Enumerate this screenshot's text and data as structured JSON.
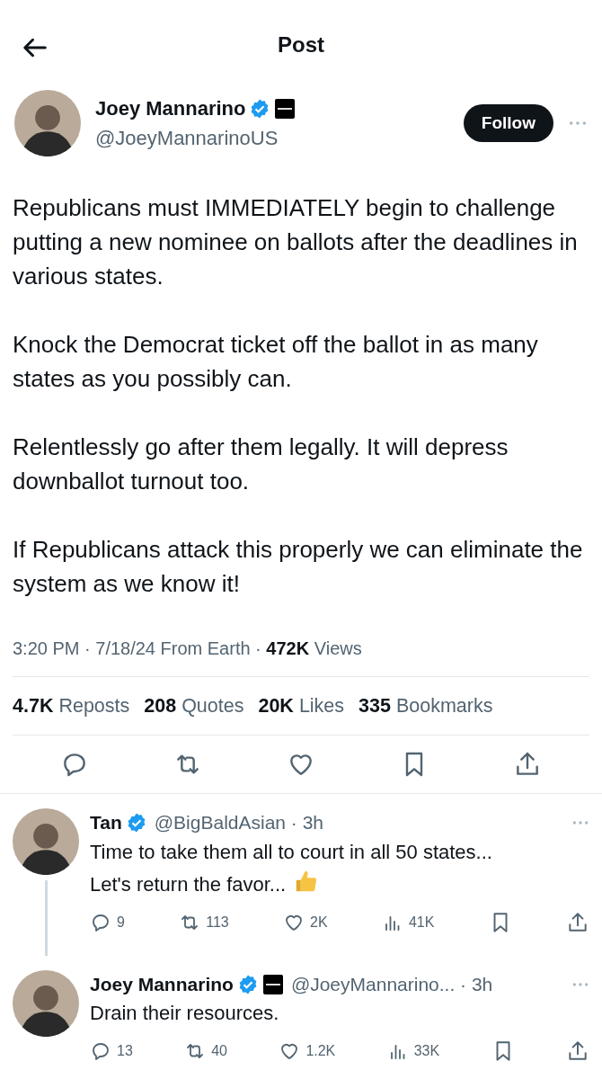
{
  "header": {
    "title": "Post"
  },
  "author": {
    "name": "Joey Mannarino",
    "verified": true,
    "handle": "@JoeyMannarinoUS",
    "follow_label": "Follow"
  },
  "paragraphs": [
    "Republicans must IMMEDIATELY begin to challenge putting a new nominee on ballots after the deadlines in various states.",
    "Knock the Democrat ticket off the ballot in as many states as you possibly can.",
    "Relentlessly go after them legally. It will depress downballot turnout too.",
    "If Republicans attack this properly we can eliminate the system as we know it!"
  ],
  "meta": {
    "text": "3:20 PM · 7/18/24 From Earth · **472K** Views"
  },
  "stats": [
    {
      "count": "4.7K",
      "label": "Reposts"
    },
    {
      "count": "208",
      "label": "Quotes"
    },
    {
      "count": "20K",
      "label": "Likes"
    },
    {
      "count": "335",
      "label": "Bookmarks"
    }
  ],
  "replies": [
    {
      "name": "Tan",
      "verified": true,
      "affiliate_badge": false,
      "handle": "@BigBaldAsian",
      "age": "· 3h",
      "text": "Time to take them all to court in all 50 states...\nLet's return the favor...",
      "thumbs_up": true,
      "replies": "9",
      "reposts": "113",
      "likes": "2K",
      "views": "41K",
      "thread_line": true
    },
    {
      "name": "Joey Mannarino",
      "verified": true,
      "affiliate_badge": true,
      "handle": "@JoeyMannarino...",
      "age": "· 3h",
      "text": "Drain their resources.",
      "thumbs_up": false,
      "replies": "13",
      "reposts": "40",
      "likes": "1.2K",
      "views": "33K",
      "thread_line": false
    }
  ]
}
